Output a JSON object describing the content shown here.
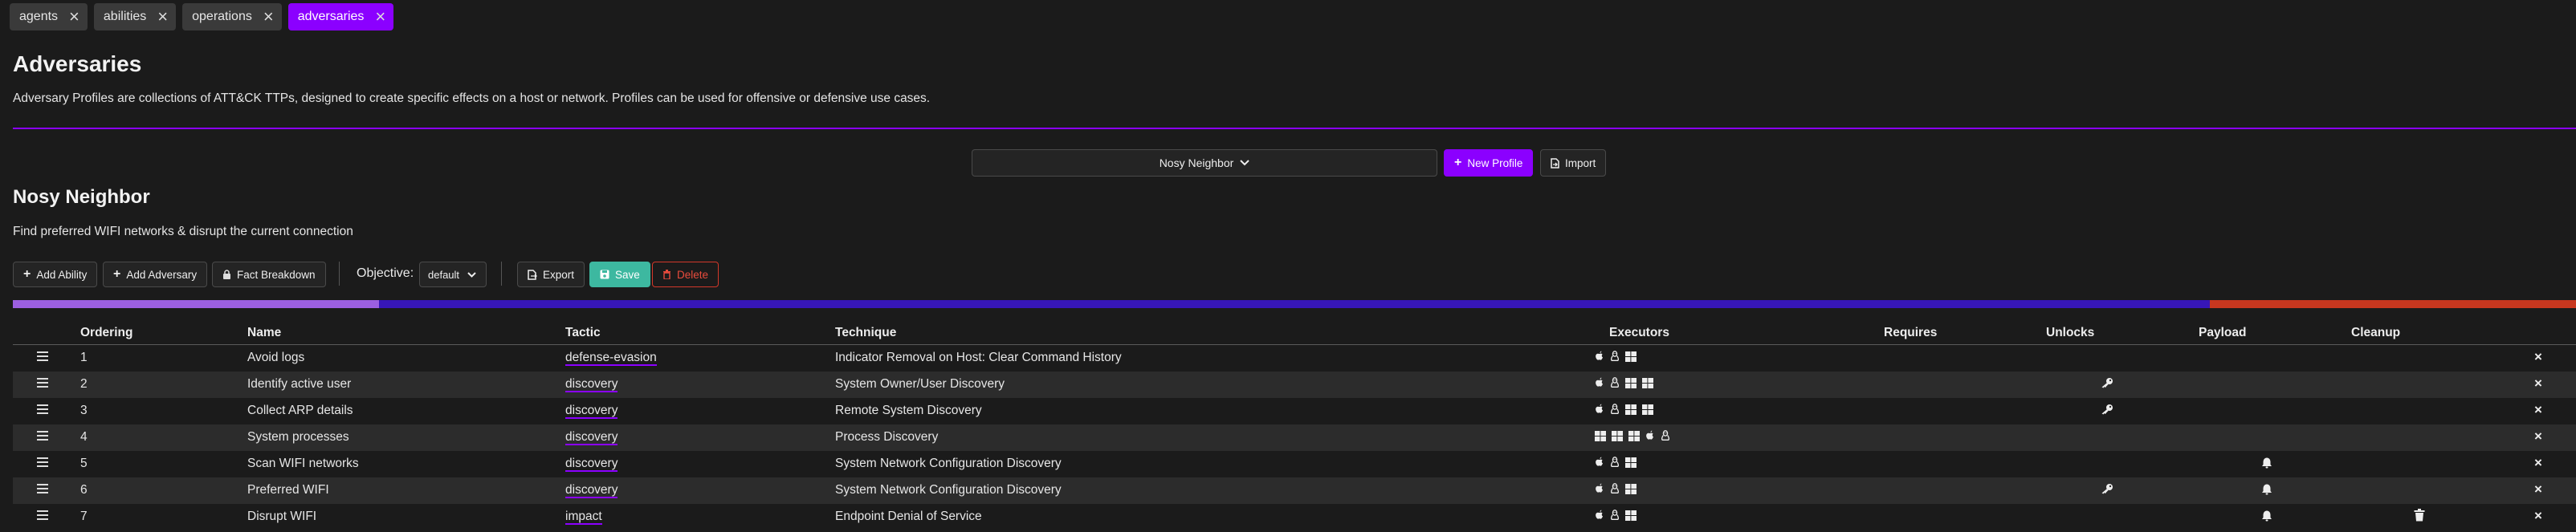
{
  "tabs": [
    {
      "label": "agents",
      "active": false
    },
    {
      "label": "abilities",
      "active": false
    },
    {
      "label": "operations",
      "active": false
    },
    {
      "label": "adversaries",
      "active": true
    }
  ],
  "page": {
    "title": "Adversaries",
    "description": "Adversary Profiles are collections of ATT&CK TTPs, designed to create specific effects on a host or network. Profiles can be used for offensive or defensive use cases."
  },
  "profile_select": {
    "selected": "Nosy Neighbor"
  },
  "buttons": {
    "new_profile": "New Profile",
    "import": "Import",
    "add_ability": "Add Ability",
    "add_adversary": "Add Adversary",
    "fact_breakdown": "Fact Breakdown",
    "export": "Export",
    "save": "Save",
    "delete": "Delete"
  },
  "adversary": {
    "name": "Nosy Neighbor",
    "description": "Find preferred WIFI networks & disrupt the current connection"
  },
  "objective": {
    "label": "Objective:",
    "selected": "default"
  },
  "tactic_bar": [
    {
      "tactic": "defense-evasion",
      "fraction": 0.143,
      "color": "#9c5fe0"
    },
    {
      "tactic": "discovery",
      "fraction": 0.714,
      "color": "#3716b8"
    },
    {
      "tactic": "impact",
      "fraction": 0.143,
      "color": "#c7371f"
    }
  ],
  "table": {
    "headers": [
      "Ordering",
      "Name",
      "Tactic",
      "Technique",
      "Executors",
      "Requires",
      "Unlocks",
      "Payload",
      "Cleanup"
    ],
    "rows": [
      {
        "order": "1",
        "name": "Avoid logs",
        "tactic": "defense-evasion",
        "technique": "Indicator Removal on Host: Clear Command History",
        "executors": [
          "apple",
          "linux",
          "windows"
        ],
        "unlocks": false,
        "payload": false,
        "cleanup": false
      },
      {
        "order": "2",
        "name": "Identify active user",
        "tactic": "discovery",
        "technique": "System Owner/User Discovery",
        "executors": [
          "apple",
          "linux",
          "windows",
          "windows"
        ],
        "unlocks": true,
        "payload": false,
        "cleanup": false
      },
      {
        "order": "3",
        "name": "Collect ARP details",
        "tactic": "discovery",
        "technique": "Remote System Discovery",
        "executors": [
          "apple",
          "linux",
          "windows",
          "windows"
        ],
        "unlocks": true,
        "payload": false,
        "cleanup": false
      },
      {
        "order": "4",
        "name": "System processes",
        "tactic": "discovery",
        "technique": "Process Discovery",
        "executors": [
          "windows",
          "windows",
          "windows",
          "apple",
          "linux"
        ],
        "unlocks": false,
        "payload": false,
        "cleanup": false
      },
      {
        "order": "5",
        "name": "Scan WIFI networks",
        "tactic": "discovery",
        "technique": "System Network Configuration Discovery",
        "executors": [
          "apple",
          "linux",
          "windows"
        ],
        "unlocks": false,
        "payload": true,
        "cleanup": false
      },
      {
        "order": "6",
        "name": "Preferred WIFI",
        "tactic": "discovery",
        "technique": "System Network Configuration Discovery",
        "executors": [
          "apple",
          "linux",
          "windows"
        ],
        "unlocks": true,
        "payload": true,
        "cleanup": false
      },
      {
        "order": "7",
        "name": "Disrupt WIFI",
        "tactic": "impact",
        "technique": "Endpoint Denial of Service",
        "executors": [
          "apple",
          "linux",
          "windows"
        ],
        "unlocks": false,
        "payload": true,
        "cleanup": true
      }
    ]
  },
  "colors": {
    "accent": "#8b00ff",
    "save": "#3db8a0",
    "danger": "#d2382a"
  }
}
